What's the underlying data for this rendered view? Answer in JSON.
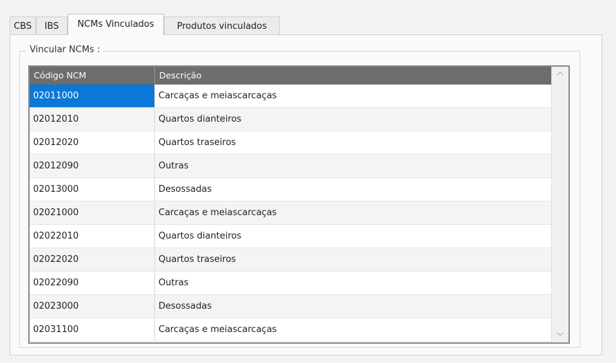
{
  "tabs": [
    {
      "label": "CBS",
      "active": false
    },
    {
      "label": "IBS",
      "active": false
    },
    {
      "label": "NCMs Vinculados",
      "active": true
    },
    {
      "label": "Produtos vinculados",
      "active": false
    }
  ],
  "group": {
    "legend": "Vincular NCMs :"
  },
  "grid": {
    "columns": [
      "Código NCM",
      "Descrição"
    ],
    "rows": [
      {
        "code": "02011000",
        "desc": "Carcaças e meiascarcaças",
        "selected": true
      },
      {
        "code": "02012010",
        "desc": "Quartos dianteiros"
      },
      {
        "code": "02012020",
        "desc": "Quartos traseiros"
      },
      {
        "code": "02012090",
        "desc": "Outras"
      },
      {
        "code": "02013000",
        "desc": "Desossadas"
      },
      {
        "code": "02021000",
        "desc": "Carcaças e meiascarcaças"
      },
      {
        "code": "02022010",
        "desc": "Quartos dianteiros"
      },
      {
        "code": "02022020",
        "desc": "Quartos traseiros"
      },
      {
        "code": "02022090",
        "desc": "Outras"
      },
      {
        "code": "02023000",
        "desc": "Desossadas"
      },
      {
        "code": "02031100",
        "desc": "Carcaças e meiascarcaças"
      }
    ]
  },
  "colors": {
    "header_bg": "#6d6d6d",
    "selection": "#0a78d7"
  },
  "icons": {
    "scroll_up": "chevron-up-icon",
    "scroll_down": "chevron-down-icon"
  }
}
